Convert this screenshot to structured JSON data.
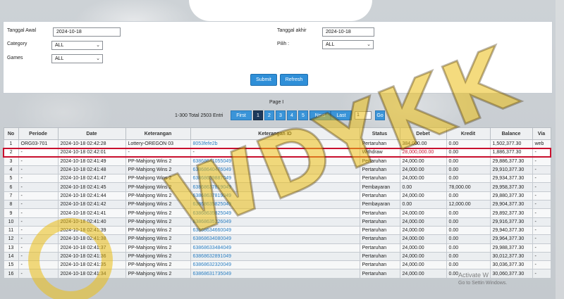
{
  "filters": {
    "tanggal_awal_label": "Tanggal Awal",
    "tanggal_awal_value": "2024-10-18",
    "tanggal_akhir_label": "Tanggal akhir",
    "tanggal_akhir_value": "2024-10-18",
    "category_label": "Category",
    "category_value": "ALL",
    "pilih_label": "Pilih   :",
    "pilih_value": "ALL",
    "games_label": "Games",
    "games_value": "ALL",
    "submit_label": "Submit",
    "refresh_label": "Refresh"
  },
  "pagination": {
    "page_title": "Page I",
    "total_info": "1-300 Total 2503 Entri",
    "first_label": "First",
    "pages": [
      "1",
      "2",
      "3",
      "4",
      "5"
    ],
    "next_label": "Next",
    "last_label": "Last",
    "goto_value": "1",
    "go_label": "Go"
  },
  "table": {
    "headers": [
      "No",
      "Periode",
      "Date",
      "Keterangan",
      "Keterangan ID",
      "Status",
      "Debet",
      "Kredit",
      "Balance",
      "Via"
    ],
    "rows": [
      [
        "1",
        "ORG03-701",
        "2024-10-18 02:42:28",
        "Lottery-OREGON 03",
        "8053fefe2b",
        "Pertaruhan",
        "384,000.00",
        "0.00",
        "1,502,377.30",
        "web"
      ],
      [
        "2",
        "-",
        "2024-10-18 02:42:01",
        "-",
        "-",
        "Withdraw",
        "28,000,000.00",
        "0.00",
        "1,886,377.30",
        "-"
      ],
      [
        "3",
        "-",
        "2024-10-18 02:41:49",
        "PP-Mahjong Wins 2",
        "63868641055049",
        "Pertaruhan",
        "24,000.00",
        "0.00",
        "29,886,377.30",
        "-"
      ],
      [
        "4",
        "-",
        "2024-10-18 02:41:48",
        "PP-Mahjong Wins 2",
        "63868640476049",
        "Pertaruhan",
        "24,000.00",
        "0.00",
        "29,910,377.30",
        "-"
      ],
      [
        "5",
        "-",
        "2024-10-18 02:41:47",
        "PP-Mahjong Wins 2",
        "63868639887049",
        "Pertaruhan",
        "24,000.00",
        "0.00",
        "29,934,377.30",
        "-"
      ],
      [
        "6",
        "-",
        "2024-10-18 02:41:45",
        "PP-Mahjong Wins 2",
        "63868637819049",
        "Pembayaran",
        "0.00",
        "78,000.00",
        "29,958,377.30",
        "-"
      ],
      [
        "7",
        "-",
        "2024-10-18 02:41:44",
        "PP-Mahjong Wins 2",
        "63868637819049",
        "Pertaruhan",
        "24,000.00",
        "0.00",
        "29,880,377.30",
        "-"
      ],
      [
        "8",
        "-",
        "2024-10-18 02:41:42",
        "PP-Mahjong Wins 2",
        "63868635825049",
        "Pembayaran",
        "0.00",
        "12,000.00",
        "29,904,377.30",
        "-"
      ],
      [
        "9",
        "-",
        "2024-10-18 02:41:41",
        "PP-Mahjong Wins 2",
        "63868635825049",
        "Pertaruhan",
        "24,000.00",
        "0.00",
        "29,892,377.30",
        "-"
      ],
      [
        "10",
        "-",
        "2024-10-18 02:41:40",
        "PP-Mahjong Wins 2",
        "63868635226049",
        "Pertaruhan",
        "24,000.00",
        "0.00",
        "29,916,377.30",
        "-"
      ],
      [
        "11",
        "-",
        "2024-10-18 02:41:39",
        "PP-Mahjong Wins 2",
        "63868634660049",
        "Pertaruhan",
        "24,000.00",
        "0.00",
        "29,940,377.30",
        "-"
      ],
      [
        "12",
        "-",
        "2024-10-18 02:41:38",
        "PP-Mahjong Wins 2",
        "63868634080049",
        "Pertaruhan",
        "24,000.00",
        "0.00",
        "29,964,377.30",
        "-"
      ],
      [
        "13",
        "-",
        "2024-10-18 02:41:37",
        "PP-Mahjong Wins 2",
        "63868633484049",
        "Pertaruhan",
        "24,000.00",
        "0.00",
        "29,988,377.30",
        "-"
      ],
      [
        "14",
        "-",
        "2024-10-18 02:41:36",
        "PP-Mahjong Wins 2",
        "63868632891049",
        "Pertaruhan",
        "24,000.00",
        "0.00",
        "30,012,377.30",
        "-"
      ],
      [
        "15",
        "-",
        "2024-10-18 02:41:35",
        "PP-Mahjong Wins 2",
        "63868632320049",
        "Pertaruhan",
        "24,000.00",
        "0.00",
        "30,036,377.30",
        "-"
      ],
      [
        "16",
        "-",
        "2024-10-18 02:41:34",
        "PP-Mahjong Wins 2",
        "63868631735049",
        "Pertaruhan",
        "24,000.00",
        "0.00",
        "30,060,377.30",
        "-"
      ]
    ]
  },
  "watermark": {
    "text": "WDYKK"
  },
  "activate": {
    "title": "Activate W",
    "subtitle": "Go to Settin       Windows."
  }
}
